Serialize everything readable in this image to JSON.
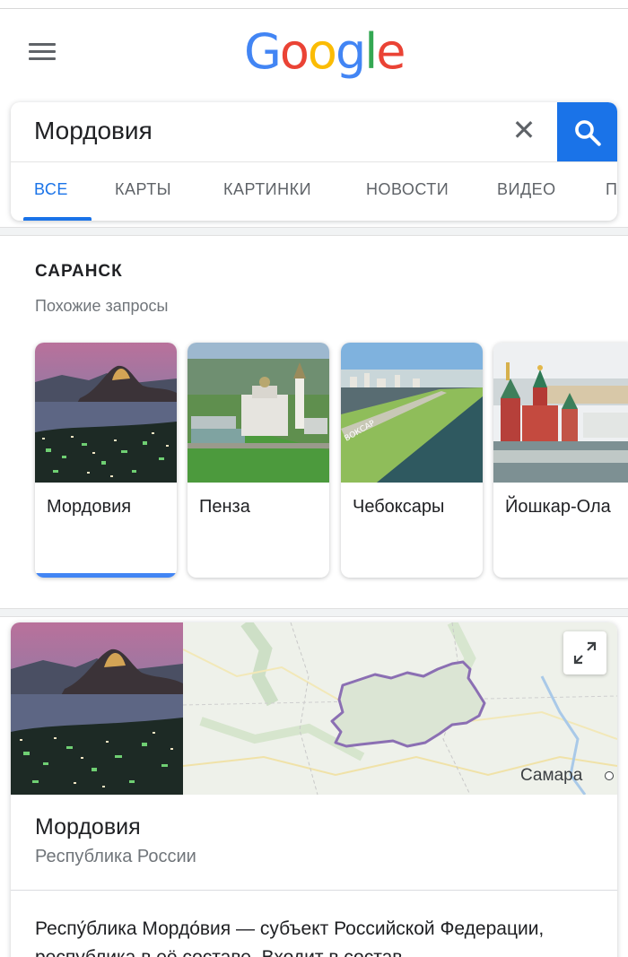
{
  "header": {
    "menu_icon": "hamburger-menu-icon",
    "logo_letters": [
      "G",
      "o",
      "o",
      "g",
      "l",
      "e"
    ],
    "logo_colors": [
      "#4285f4",
      "#ea4335",
      "#fbbc05",
      "#4285f4",
      "#34a853",
      "#ea4335"
    ]
  },
  "search": {
    "query": "Мордовия",
    "clear_icon": "close-icon",
    "clear_glyph": "✕",
    "submit_icon": "search-icon",
    "accent_color": "#1a73e8"
  },
  "tabs": [
    {
      "label": "ВСЕ",
      "active": true
    },
    {
      "label": "КАРТЫ",
      "active": false
    },
    {
      "label": "КАРТИНКИ",
      "active": false
    },
    {
      "label": "НОВОСТИ",
      "active": false
    },
    {
      "label": "ВИДЕО",
      "active": false
    },
    {
      "label": "П",
      "active": false
    }
  ],
  "related": {
    "heading": "САРАНСК",
    "subheading": "Похожие запросы",
    "items": [
      {
        "label": "Мордовия",
        "active": true
      },
      {
        "label": "Пенза",
        "active": false
      },
      {
        "label": "Чебоксары",
        "active": false
      },
      {
        "label": "Йошкар-Ола",
        "active": false
      }
    ]
  },
  "knowledge_panel": {
    "title": "Мордовия",
    "subtitle": "Республика России",
    "map_city": "Самара",
    "expand_icon": "expand-icon",
    "description": "Респу́блика Мордо́вия — субъект Российской Федерации, республика в её составе. Входит в состав"
  }
}
